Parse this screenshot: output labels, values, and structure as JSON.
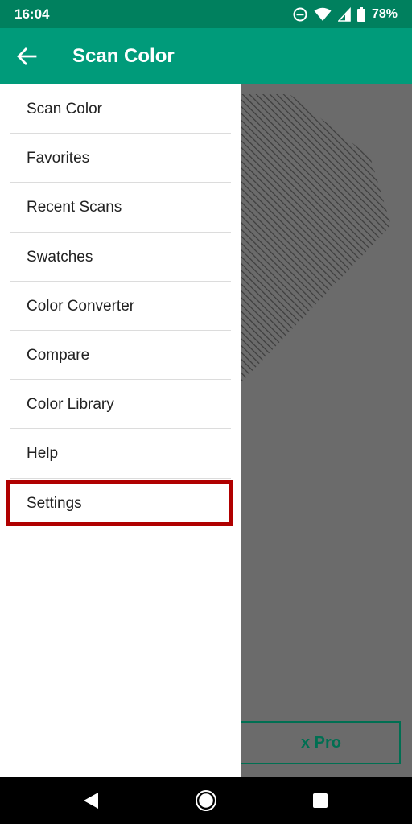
{
  "status_bar": {
    "time": "16:04",
    "battery_percent": "78%"
  },
  "app_bar": {
    "title": "Scan Color"
  },
  "drawer": {
    "items": [
      {
        "label": "Scan Color"
      },
      {
        "label": "Favorites"
      },
      {
        "label": "Recent Scans"
      },
      {
        "label": "Swatches"
      },
      {
        "label": "Color Converter"
      },
      {
        "label": "Compare"
      },
      {
        "label": "Color Library"
      },
      {
        "label": "Help"
      },
      {
        "label": "Settings",
        "highlighted": true
      }
    ]
  },
  "background": {
    "pro_button_label": "x Pro"
  },
  "colors": {
    "status_bar": "#00805e",
    "app_bar": "#009b7a",
    "highlight": "#b00000",
    "scrim": "#6b6b6b"
  },
  "icons": [
    "dnd-icon",
    "wifi-icon",
    "signal-icon",
    "battery-icon",
    "back-arrow-icon",
    "nav-back-icon",
    "nav-home-icon",
    "nav-recents-icon"
  ]
}
